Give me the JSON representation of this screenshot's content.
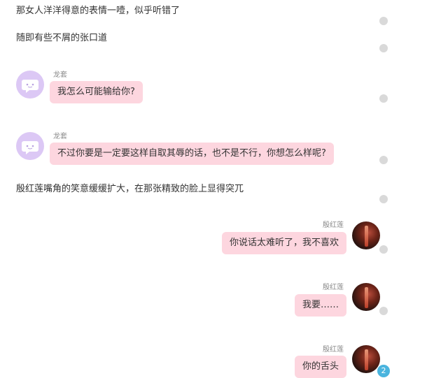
{
  "messages": [
    {
      "type": "narration",
      "text": "那女人洋洋得意的表情一噎，似乎听错了"
    },
    {
      "type": "narration",
      "text": "随即有些不屑的张口道"
    },
    {
      "type": "left",
      "name": "龙套",
      "text": "我怎么可能输给你?"
    },
    {
      "type": "left",
      "name": "龙套",
      "text": "不过你要是一定要这样自取其辱的话，也不是不行，你想怎么样呢?"
    },
    {
      "type": "narration",
      "text": "殷红莲嘴角的笑意缓缓扩大，在那张精致的脸上显得突兀"
    },
    {
      "type": "right",
      "name": "殷红莲",
      "text": "你说话太难听了，我不喜欢"
    },
    {
      "type": "right",
      "name": "殷红莲",
      "text": "我要……"
    },
    {
      "type": "right",
      "name": "殷红莲",
      "text": "你的舌头"
    }
  ],
  "badge_count": "2",
  "icons": {
    "bot_avatar": "chat-bubble-icon",
    "read_dot": "status-dot-icon"
  }
}
